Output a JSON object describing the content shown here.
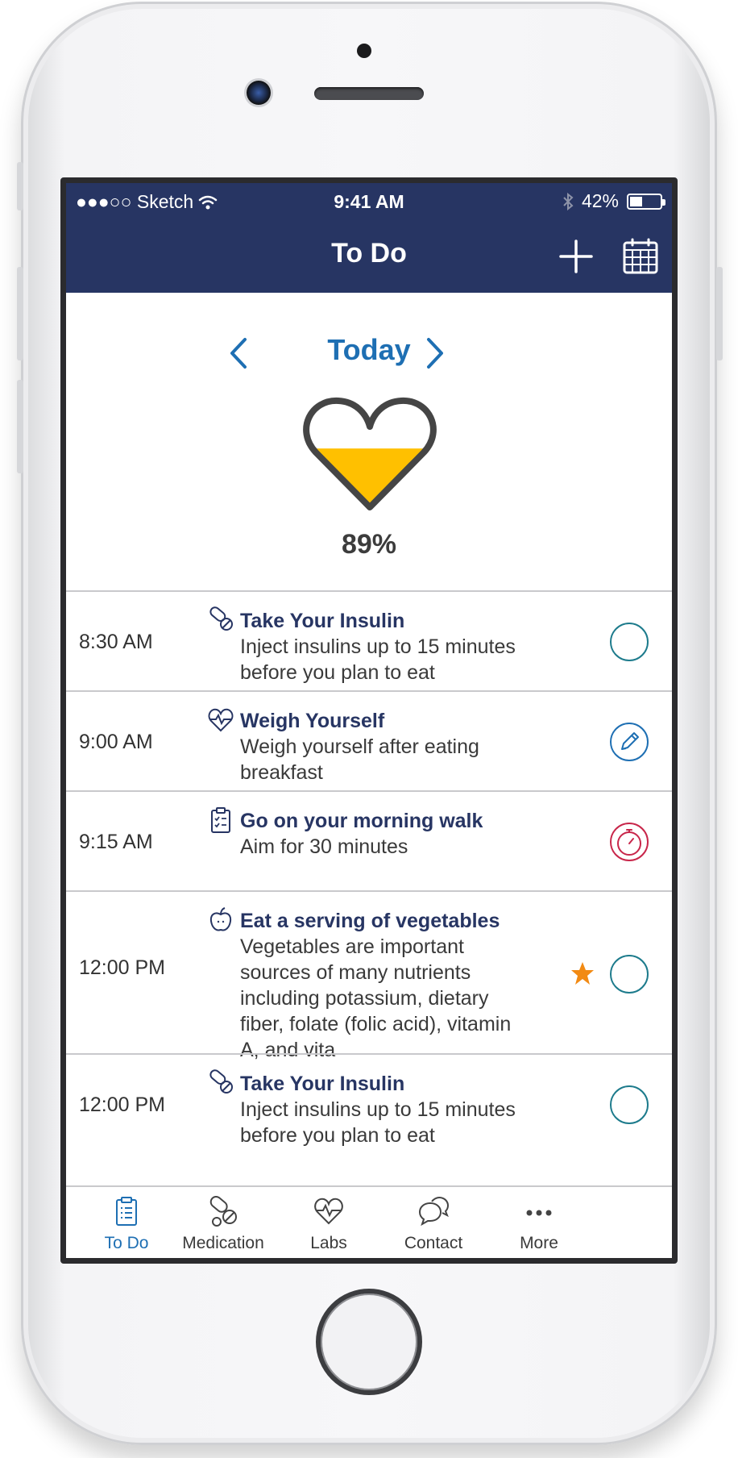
{
  "status_bar": {
    "carrier": "●●●○○ Sketch",
    "time": "9:41 AM",
    "battery_percent": "42%",
    "battery_level": 0.42
  },
  "header": {
    "title": "To Do",
    "add_icon": "plus-icon",
    "calendar_icon": "calendar-icon"
  },
  "date_nav": {
    "label": "Today",
    "prev_icon": "chevron-left-icon",
    "next_icon": "chevron-right-icon"
  },
  "progress": {
    "percent_label": "89%",
    "fill_fraction": 0.89,
    "fill_color": "#FFC000"
  },
  "tasks": [
    {
      "time": "8:30 AM",
      "icon": "pills-icon",
      "title": "Take Your Insulin",
      "description": "Inject insulins up to 15 minutes before you plan to eat",
      "action": "checkbox-circle"
    },
    {
      "time": "9:00 AM",
      "icon": "heart-pulse-icon",
      "title": "Weigh Yourself",
      "description": "Weigh yourself after eating breakfast",
      "action": "pen-icon"
    },
    {
      "time": "9:15 AM",
      "icon": "clipboard-icon",
      "title": "Go on your morning walk",
      "description": "Aim for 30 minutes",
      "action": "stopwatch-icon"
    },
    {
      "time": "12:00 PM",
      "icon": "apple-icon",
      "title": "Eat a serving of vegetables",
      "description": "Vegetables are important sources of many nutrients including potassium, dietary fiber, folate (folic acid), vitamin A, and vita",
      "action": "checkbox-circle",
      "starred": true
    },
    {
      "time": "12:00 PM",
      "icon": "pills-icon",
      "title": "Take Your Insulin",
      "description": "Inject insulins up to 15 minutes before you plan to eat",
      "action": "checkbox-circle"
    }
  ],
  "tab_bar": [
    {
      "label": "To Do",
      "icon": "clipboard-icon",
      "active": true
    },
    {
      "label": "Medication",
      "icon": "pills-icon",
      "active": false
    },
    {
      "label": "Labs",
      "icon": "heart-pulse-icon",
      "active": false
    },
    {
      "label": "Contact",
      "icon": "chat-bubbles-icon",
      "active": false
    },
    {
      "label": "More",
      "icon": "more-dots-icon",
      "active": false
    }
  ],
  "colors": {
    "header_bg": "#273563",
    "accent_blue": "#1E6FB3",
    "task_title": "#273563",
    "check_teal": "#1D7B8C",
    "stopwatch_red": "#C8264A",
    "star_orange": "#F28A13"
  }
}
